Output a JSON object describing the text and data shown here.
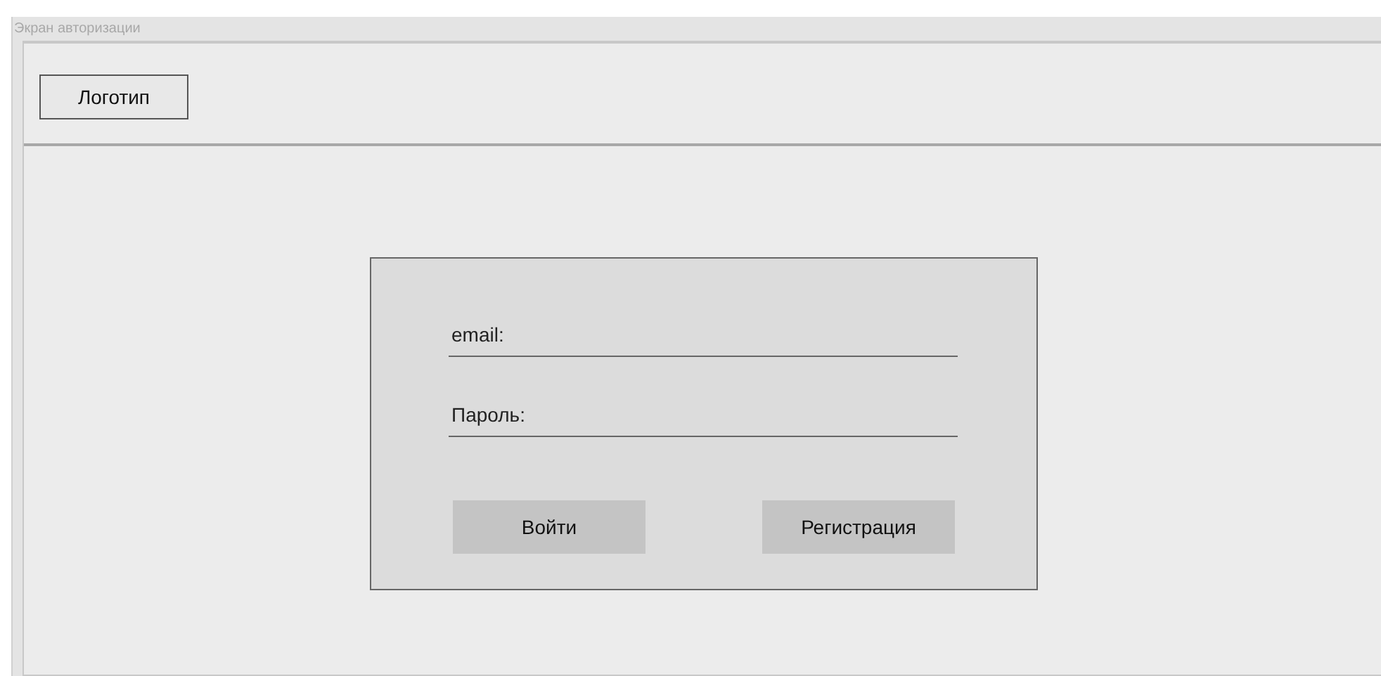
{
  "window": {
    "title": "Экран авторизации"
  },
  "header": {
    "logo": "Логотип"
  },
  "login_form": {
    "fields": [
      {
        "placeholder": "email:"
      },
      {
        "placeholder": "Пароль:"
      }
    ],
    "buttons": [
      "Войти",
      "Регистрация"
    ]
  }
}
